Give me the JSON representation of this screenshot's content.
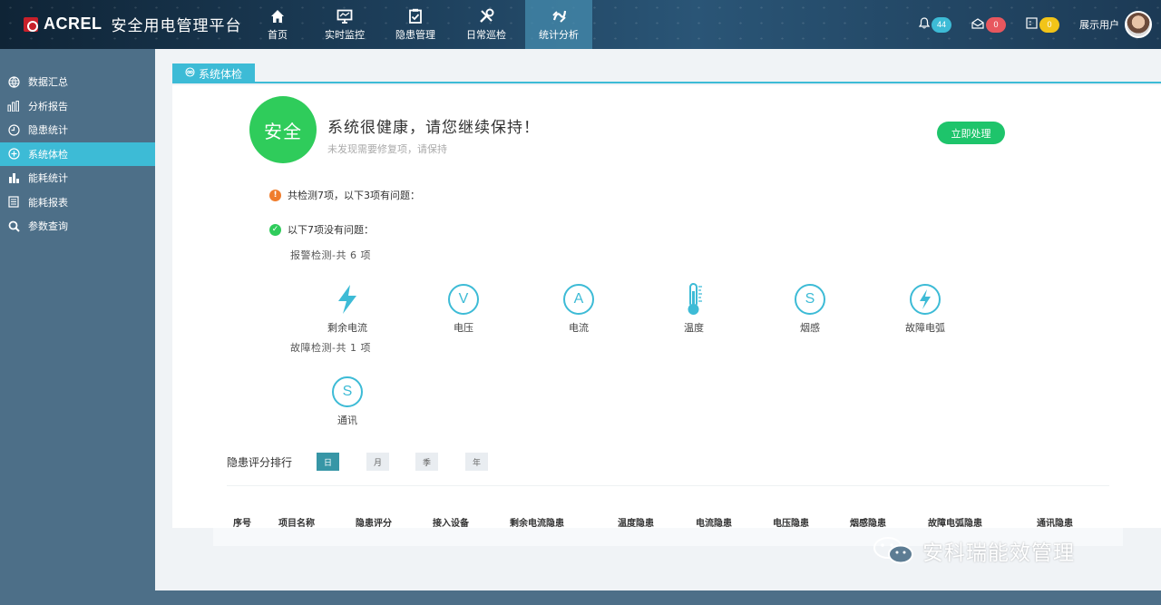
{
  "header": {
    "brand": "ACREL",
    "title": "安全用电管理平台",
    "nav": [
      {
        "label": "首页",
        "icon": "home-icon"
      },
      {
        "label": "实时监控",
        "icon": "monitor-icon"
      },
      {
        "label": "隐患管理",
        "icon": "clipboard-check-icon"
      },
      {
        "label": "日常巡检",
        "icon": "tools-icon"
      },
      {
        "label": "统计分析",
        "icon": "chart-analysis-icon",
        "active": true
      }
    ],
    "badges": {
      "bell": "44",
      "mail": "0",
      "message": "0"
    },
    "user": "展示用户"
  },
  "sidebar": {
    "items": [
      {
        "label": "数据汇总",
        "icon": "globe-icon"
      },
      {
        "label": "分析报告",
        "icon": "bar-chart-icon"
      },
      {
        "label": "隐患统计",
        "icon": "clock-icon"
      },
      {
        "label": "系统体检",
        "icon": "plus-circle-icon",
        "active": true
      },
      {
        "label": "能耗统计",
        "icon": "column-chart-icon"
      },
      {
        "label": "能耗报表",
        "icon": "report-icon"
      },
      {
        "label": "参数查询",
        "icon": "search-icon"
      }
    ]
  },
  "main": {
    "tab": "系统体检",
    "status_badge": "安全",
    "health_title": "系统很健康，请您继续保持！",
    "health_sub": "未发现需要修复项，请保持",
    "action_button": "立即处理",
    "summary_line": "共检测7项，以下3项有问题：",
    "ok_line": "以下7项没有问题：",
    "alarm_group": "报警检测-共 6 项",
    "fault_group": "故障检测-共 1 项",
    "alarm_items": [
      {
        "label": "剩余电流",
        "icon": "lightning-icon"
      },
      {
        "label": "电压",
        "icon": "voltage-icon",
        "glyph": "V"
      },
      {
        "label": "电流",
        "icon": "current-icon",
        "glyph": "A"
      },
      {
        "label": "温度",
        "icon": "thermometer-icon"
      },
      {
        "label": "烟感",
        "icon": "smoke-icon",
        "glyph": "S"
      },
      {
        "label": "故障电弧",
        "icon": "arc-fault-icon"
      }
    ],
    "fault_items": [
      {
        "label": "通讯",
        "icon": "communication-icon",
        "glyph": "S"
      }
    ],
    "ranking": {
      "title": "隐患评分排行",
      "periods": [
        "日",
        "月",
        "季",
        "年"
      ],
      "active_period": "日",
      "columns": [
        "序号",
        "项目名称",
        "隐患评分",
        "接入设备",
        "剩余电流隐患",
        "温度隐患",
        "电流隐患",
        "电压隐患",
        "烟感隐患",
        "故障电弧隐患",
        "通讯隐患"
      ]
    }
  },
  "watermark": "安科瑞能效管理",
  "colors": {
    "accent": "#3dbbd6",
    "safe": "#2fcc5b",
    "button": "#1ec46b",
    "warn": "#f07d2c"
  }
}
